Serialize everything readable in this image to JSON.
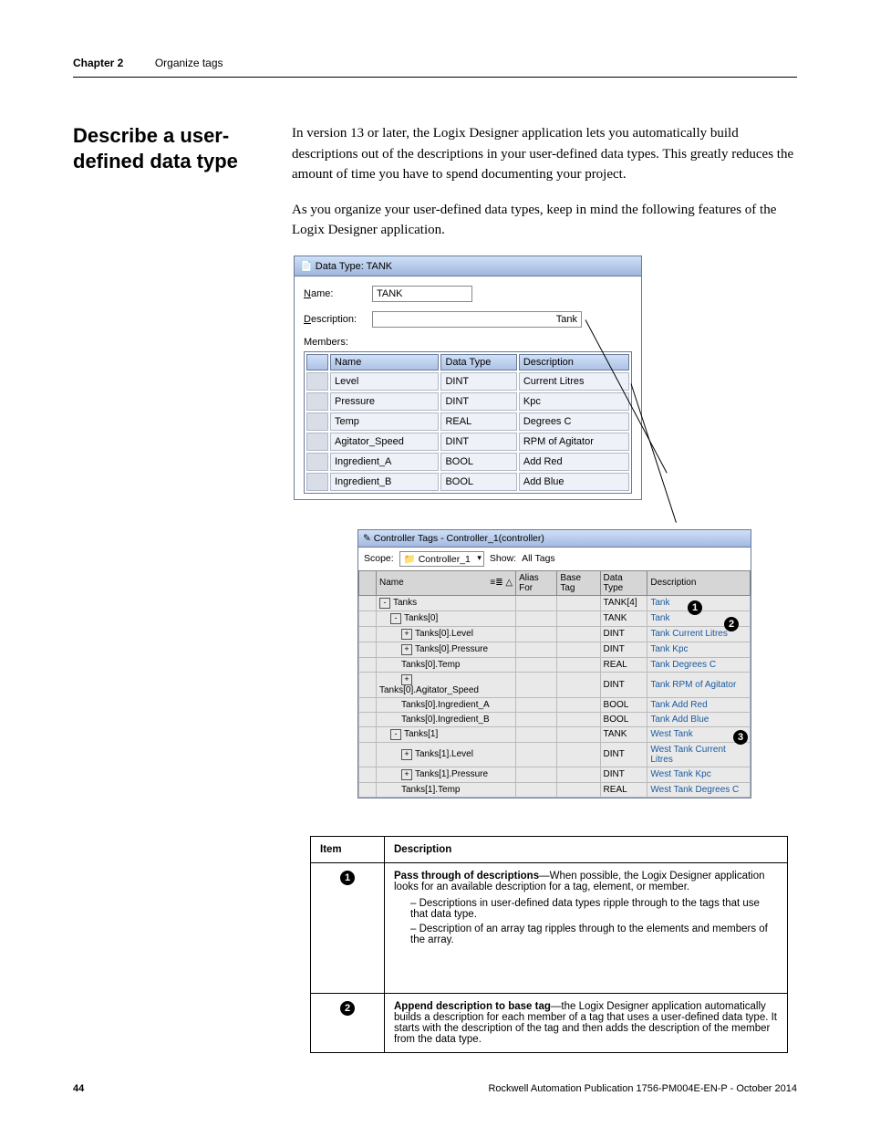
{
  "header": {
    "chapter": "Chapter 2",
    "section": "Organize tags"
  },
  "heading": "Describe a user-defined data type",
  "para1": "In version 13 or later, the Logix Designer application lets you automatically build descriptions out of the descriptions in your user-defined data types. This greatly reduces the amount of time you have to spend documenting your project.",
  "para2": "As you organize your user-defined data types, keep in mind the following features of the Logix Designer application.",
  "ss1": {
    "title": "Data Type: TANK",
    "name_label": "Name:",
    "name_value": "TANK",
    "desc_label": "Description:",
    "desc_value": "Tank",
    "members_label": "Members:",
    "cols": {
      "name": "Name",
      "dtype": "Data Type",
      "desc": "Description"
    },
    "rows": [
      {
        "name": "Level",
        "dt": "DINT",
        "d": "Current Litres"
      },
      {
        "name": "Pressure",
        "dt": "DINT",
        "d": "Kpc"
      },
      {
        "name": "Temp",
        "dt": "REAL",
        "d": "Degrees C"
      },
      {
        "name": "Agitator_Speed",
        "dt": "DINT",
        "d": "RPM of Agitator"
      },
      {
        "name": "Ingredient_A",
        "dt": "BOOL",
        "d": "Add Red"
      },
      {
        "name": "Ingredient_B",
        "dt": "BOOL",
        "d": "Add Blue"
      }
    ]
  },
  "ss2": {
    "title": "Controller Tags - Controller_1(controller)",
    "scope_label": "Scope:",
    "scope_value": "Controller_1",
    "show_label": "Show:",
    "show_value": "All Tags",
    "cols": {
      "name": "Name",
      "sort": "≡≣ △",
      "alias": "Alias For",
      "base": "Base Tag",
      "dtype": "Data Type",
      "desc": "Description"
    },
    "rows": [
      {
        "ind": 0,
        "box": "-",
        "name": "Tanks",
        "dt": "TANK[4]",
        "d": "Tank"
      },
      {
        "ind": 1,
        "box": "-",
        "name": "Tanks[0]",
        "dt": "TANK",
        "d": "Tank"
      },
      {
        "ind": 2,
        "box": "+",
        "name": "Tanks[0].Level",
        "dt": "DINT",
        "d": "Tank Current Litres"
      },
      {
        "ind": 2,
        "box": "+",
        "name": "Tanks[0].Pressure",
        "dt": "DINT",
        "d": "Tank Kpc"
      },
      {
        "ind": 2,
        "box": "",
        "name": "Tanks[0].Temp",
        "dt": "REAL",
        "d": "Tank Degrees C"
      },
      {
        "ind": 2,
        "box": "+",
        "name": "Tanks[0].Agitator_Speed",
        "dt": "DINT",
        "d": "Tank RPM of Agitator"
      },
      {
        "ind": 2,
        "box": "",
        "name": "Tanks[0].Ingredient_A",
        "dt": "BOOL",
        "d": "Tank Add Red"
      },
      {
        "ind": 2,
        "box": "",
        "name": "Tanks[0].Ingredient_B",
        "dt": "BOOL",
        "d": "Tank Add Blue"
      },
      {
        "ind": 1,
        "box": "-",
        "name": "Tanks[1]",
        "dt": "TANK",
        "d": "West Tank"
      },
      {
        "ind": 2,
        "box": "+",
        "name": "Tanks[1].Level",
        "dt": "DINT",
        "d": "West Tank Current Litres"
      },
      {
        "ind": 2,
        "box": "+",
        "name": "Tanks[1].Pressure",
        "dt": "DINT",
        "d": "West Tank Kpc"
      },
      {
        "ind": 2,
        "box": "",
        "name": "Tanks[1].Temp",
        "dt": "REAL",
        "d": "West Tank Degrees C"
      }
    ]
  },
  "callouts": {
    "c1": "1",
    "c2": "2",
    "c3": "3"
  },
  "item_table": {
    "head": {
      "item": "Item",
      "desc": "Description"
    },
    "row1": {
      "lead": "Pass through of descriptions",
      "rest": "—When possible, the Logix Designer application looks for an available description for a tag, element, or member.",
      "b1": "Descriptions in user-defined data types ripple through to the tags that use that data type.",
      "b2": "Description of an array tag ripples through to the elements and members of the array."
    },
    "row2": {
      "lead": "Append description to base tag",
      "rest": "—the Logix Designer application automatically builds a description for each member of a tag that uses a user-defined data type. It starts with the description of the tag and then adds the description of the member from the data type."
    }
  },
  "footer": {
    "page": "44",
    "pub": "Rockwell Automation Publication 1756-PM004E-EN-P - October 2014"
  }
}
